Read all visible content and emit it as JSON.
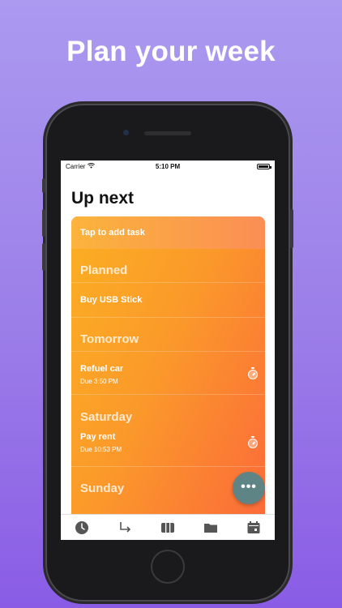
{
  "headline": "Plan your week",
  "status": {
    "carrier": "Carrier",
    "time": "5:10 PM"
  },
  "page_title": "Up next",
  "add_task": "Tap to add task",
  "sections": {
    "planned": "Planned",
    "tomorrow": "Tomorrow",
    "saturday": "Saturday",
    "sunday": "Sunday"
  },
  "tasks": [
    {
      "name": "Buy USB Stick"
    },
    {
      "name": "Refuel car",
      "due": "Due 3:50 PM"
    },
    {
      "name": "Pay rent",
      "due": "Due 10:53 PM"
    }
  ],
  "fab_label": "•••",
  "tabs": [
    {
      "icon": "clock-icon"
    },
    {
      "icon": "arrow-turn-icon"
    },
    {
      "icon": "board-icon"
    },
    {
      "icon": "folder-icon"
    },
    {
      "icon": "calendar-icon"
    }
  ],
  "colors": {
    "accent": "#fb8e3a",
    "fab": "#5f8486",
    "background": "#9b7de8"
  }
}
